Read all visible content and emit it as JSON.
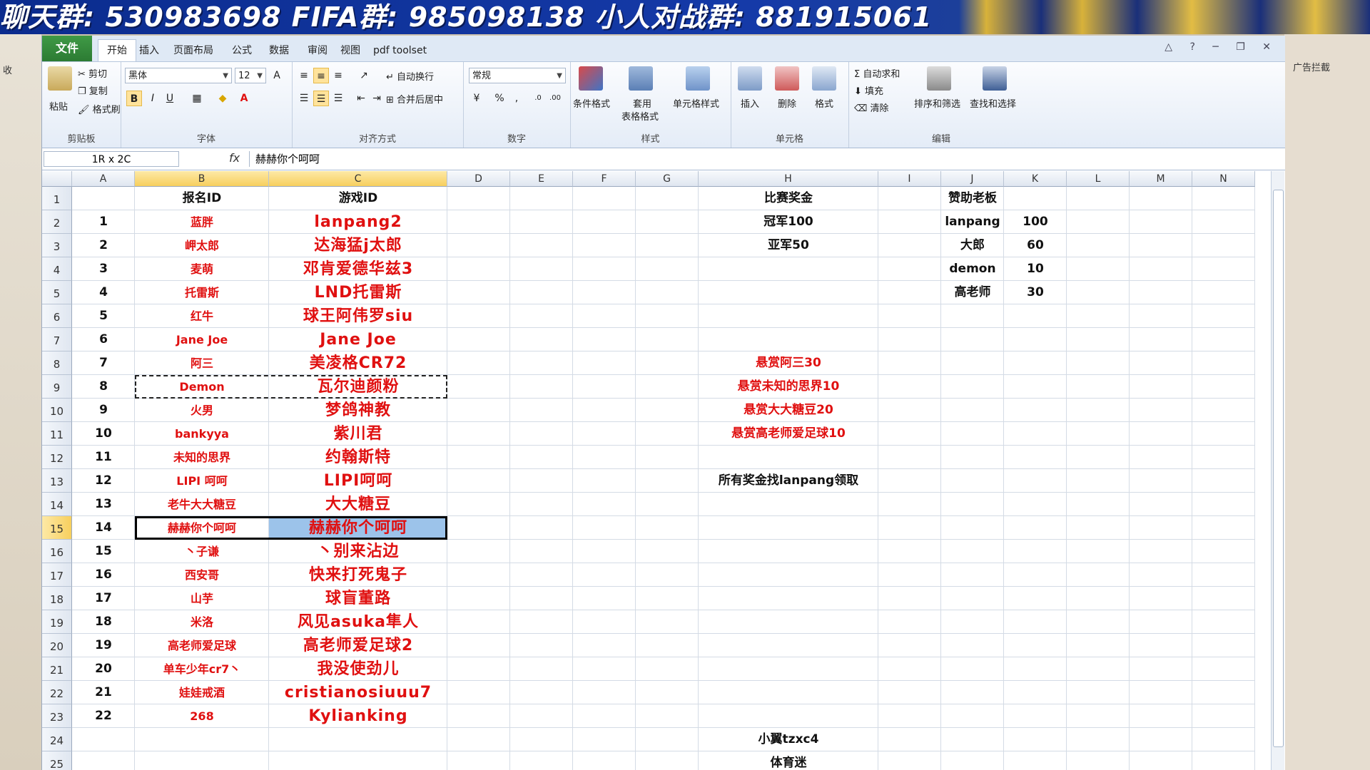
{
  "banner": {
    "text": "聊天群: 530983698   FIFA群: 985098138   小人对战群: 881915061"
  },
  "side": {
    "left_text": "收",
    "right_text": "广告拦截"
  },
  "tabs": {
    "file": "文件",
    "items": [
      "开始",
      "插入",
      "页面布局",
      "公式",
      "数据",
      "审阅",
      "视图",
      "pdf toolset"
    ],
    "active": "开始"
  },
  "ribbon": {
    "clipboard": {
      "label": "剪贴板",
      "paste": "粘贴",
      "cut": "剪切",
      "copy": "复制",
      "format_painter": "格式刷"
    },
    "font": {
      "label": "字体",
      "name": "黑体",
      "size": "12"
    },
    "align": {
      "label": "对齐方式",
      "wrap": "自动换行",
      "merge": "合并后居中"
    },
    "number": {
      "label": "数字",
      "format": "常规"
    },
    "styles": {
      "label": "样式",
      "conditional": "条件格式",
      "table_1": "套用",
      "table_2": "表格格式",
      "cell_style": "单元格样式"
    },
    "cells": {
      "label": "单元格",
      "insert": "插入",
      "delete": "删除",
      "format": "格式"
    },
    "edit": {
      "label": "编辑",
      "autosum": "自动求和",
      "fill": "填充",
      "clear": "清除",
      "sort": "排序和筛选",
      "find": "查找和选择"
    }
  },
  "formula_bar": {
    "name_box": "1R x 2C",
    "fx": "fx",
    "content": "赫赫你个呵呵"
  },
  "columns": [
    "A",
    "B",
    "C",
    "D",
    "E",
    "F",
    "G",
    "H",
    "I",
    "J",
    "K",
    "L",
    "M",
    "N"
  ],
  "selected_row": "15",
  "rows": [
    {
      "n": "1",
      "A": "",
      "B": "报名ID",
      "C": "游戏ID",
      "H": "比赛奖金",
      "J": "赞助老板",
      "K": ""
    },
    {
      "n": "2",
      "A": "1",
      "B": "蓝胖",
      "C": "lanpang2",
      "H": "冠军100",
      "J": "lanpang",
      "K": "100"
    },
    {
      "n": "3",
      "A": "2",
      "B": "岬太郎",
      "C": "达海猛j太郎",
      "H": "亚军50",
      "J": "大郎",
      "K": "60"
    },
    {
      "n": "4",
      "A": "3",
      "B": "麦萌",
      "C": "邓肯爱德华兹3",
      "H": "",
      "J": "demon",
      "K": "10"
    },
    {
      "n": "5",
      "A": "4",
      "B": "托雷斯",
      "C": "LND托雷斯",
      "H": "",
      "J": "高老师",
      "K": "30"
    },
    {
      "n": "6",
      "A": "5",
      "B": "红牛",
      "C": "球王阿伟罗siu",
      "H": "",
      "J": "",
      "K": ""
    },
    {
      "n": "7",
      "A": "6",
      "B": "Jane Joe",
      "C": "Jane Joe",
      "H": "",
      "J": "",
      "K": ""
    },
    {
      "n": "8",
      "A": "7",
      "B": "阿三",
      "C": "美凌格CR72",
      "H": "悬赏阿三30",
      "J": "",
      "K": ""
    },
    {
      "n": "9",
      "A": "8",
      "B": "Demon",
      "C": "瓦尔迪颜粉",
      "H": "悬赏未知的思界10",
      "J": "",
      "K": ""
    },
    {
      "n": "10",
      "A": "9",
      "B": "火男",
      "C": "梦鸽神教",
      "H": "悬赏大大糖豆20",
      "J": "",
      "K": ""
    },
    {
      "n": "11",
      "A": "10",
      "B": "bankyya",
      "C": "紫川君",
      "H": "悬赏高老师爱足球10",
      "J": "",
      "K": ""
    },
    {
      "n": "12",
      "A": "11",
      "B": "未知的思界",
      "C": "约翰斯特",
      "H": "",
      "J": "",
      "K": ""
    },
    {
      "n": "13",
      "A": "12",
      "B": "LIPI 呵呵",
      "C": "LIPI呵呵",
      "H": "所有奖金找lanpang领取",
      "J": "",
      "K": ""
    },
    {
      "n": "14",
      "A": "13",
      "B": "老牛大大糖豆",
      "C": "大大糖豆",
      "H": "",
      "J": "",
      "K": ""
    },
    {
      "n": "15",
      "A": "14",
      "B": "赫赫你个呵呵",
      "C": "赫赫你个呵呵",
      "H": "",
      "J": "",
      "K": ""
    },
    {
      "n": "16",
      "A": "15",
      "B": "丶子谦",
      "C": "丶别来沾边",
      "H": "",
      "J": "",
      "K": ""
    },
    {
      "n": "17",
      "A": "16",
      "B": "西安哥",
      "C": "快来打死鬼子",
      "H": "",
      "J": "",
      "K": ""
    },
    {
      "n": "18",
      "A": "17",
      "B": "山芋",
      "C": "球盲董路",
      "H": "",
      "J": "",
      "K": ""
    },
    {
      "n": "19",
      "A": "18",
      "B": "米洛",
      "C": "风见asuka隼人",
      "H": "",
      "J": "",
      "K": ""
    },
    {
      "n": "20",
      "A": "19",
      "B": "高老师爱足球",
      "C": "高老师爱足球2",
      "H": "",
      "J": "",
      "K": ""
    },
    {
      "n": "21",
      "A": "20",
      "B": "单车少年cr7丶",
      "C": "我没使劲儿",
      "H": "",
      "J": "",
      "K": ""
    },
    {
      "n": "22",
      "A": "21",
      "B": "娃娃戒酒",
      "C": "cristianosiuuu7",
      "H": "",
      "J": "",
      "K": ""
    },
    {
      "n": "23",
      "A": "22",
      "B": "268",
      "C": "Kylianking",
      "H": "",
      "J": "",
      "K": ""
    },
    {
      "n": "24",
      "A": "",
      "B": "",
      "C": "",
      "H": "小翼tzxc4",
      "J": "",
      "K": ""
    },
    {
      "n": "25",
      "A": "",
      "B": "",
      "C": "",
      "H": "体育迷",
      "J": "",
      "K": ""
    }
  ]
}
